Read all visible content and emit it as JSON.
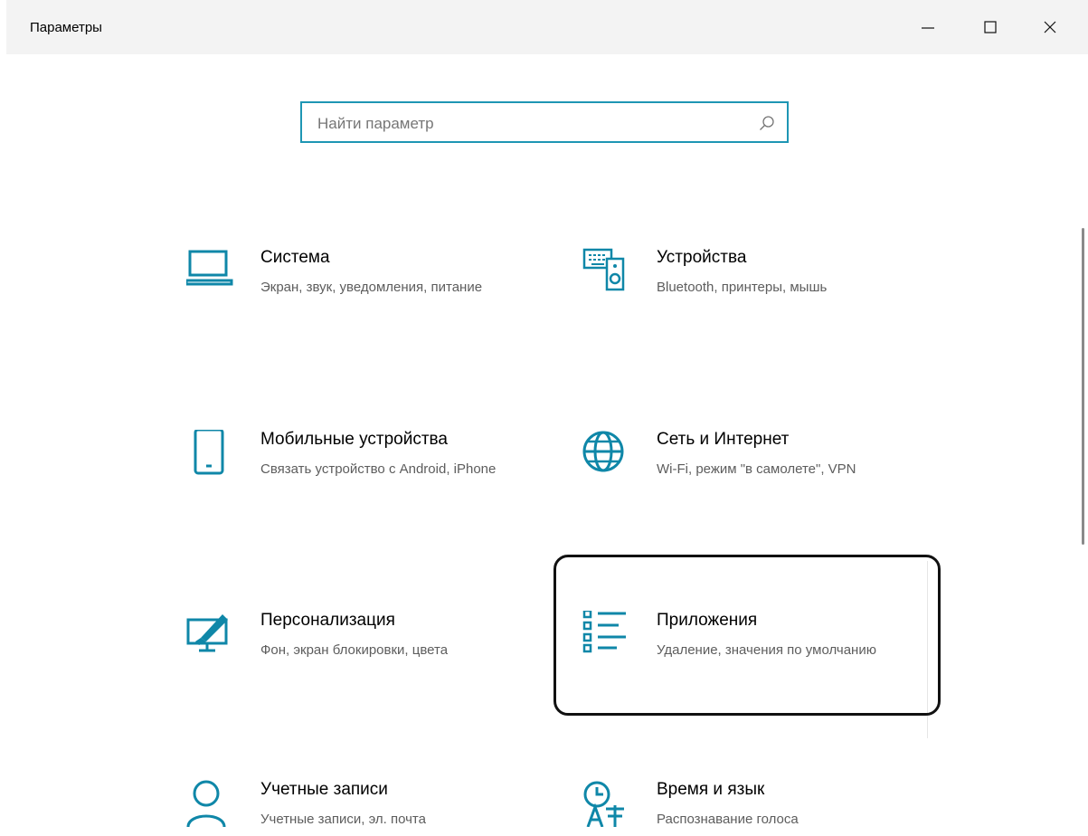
{
  "window": {
    "title": "Параметры",
    "controls": {
      "minimize": "—",
      "maximize": "☐",
      "close": "✕"
    }
  },
  "search": {
    "placeholder": "Найти параметр"
  },
  "accent_color": "#0f87a8",
  "tiles": [
    {
      "name": "Система",
      "desc": "Экран, звук, уведомления, питание",
      "icon": "laptop-icon"
    },
    {
      "name": "Устройства",
      "desc": "Bluetooth, принтеры, мышь",
      "icon": "devices-icon"
    },
    {
      "name": "Мобильные устройства",
      "desc": "Связать устройство с Android, iPhone",
      "icon": "phone-icon"
    },
    {
      "name": "Сеть и Интернет",
      "desc": "Wi-Fi, режим \"в самолете\", VPN",
      "icon": "globe-icon"
    },
    {
      "name": "Персонализация",
      "desc": "Фон, экран блокировки, цвета",
      "icon": "personalization-icon"
    },
    {
      "name": "Приложения",
      "desc": "Удаление, значения по умолчанию",
      "icon": "apps-list-icon",
      "selected": true
    },
    {
      "name": "Учетные записи",
      "desc": "Учетные записи, эл. почта",
      "icon": "person-icon"
    },
    {
      "name": "Время и язык",
      "desc": "Распознавание голоса",
      "icon": "time-language-icon"
    }
  ]
}
